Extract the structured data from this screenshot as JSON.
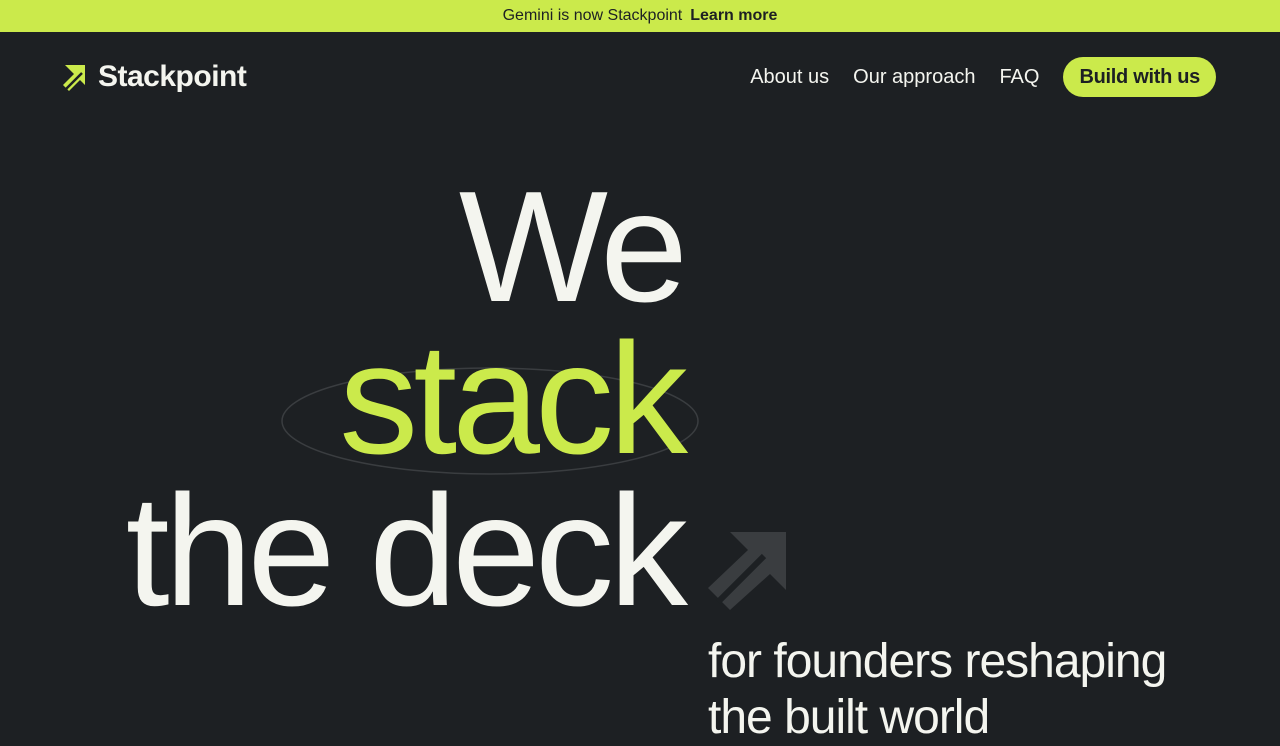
{
  "colors": {
    "background": "#1d2023",
    "accent": "#cbea4b",
    "text": "#f4f5ef",
    "deco_arrow": "#3a3d40"
  },
  "announcement": {
    "text": "Gemini is now Stackpoint",
    "link_label": "Learn more"
  },
  "header": {
    "logo_icon": "arrow-up-right-icon",
    "logo_text": "Stackpoint",
    "nav": {
      "about": "About us",
      "approach": "Our approach",
      "faq": "FAQ",
      "cta": "Build with us"
    }
  },
  "hero": {
    "line1": "We",
    "line2": "stack",
    "line3": "the deck",
    "deco_icon": "arrow-up-right-icon",
    "subline1": "for founders reshaping",
    "subline2": "the built world"
  }
}
